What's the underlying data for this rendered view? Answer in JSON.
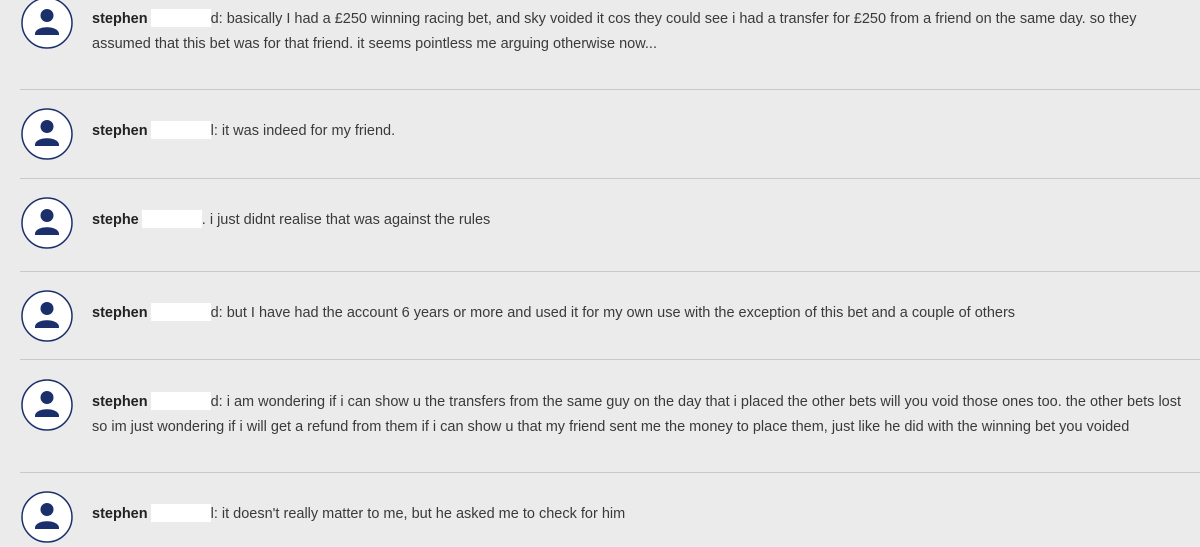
{
  "messages": [
    {
      "sender": "stephen",
      "separator": "d:",
      "text": "basically I had a £250 winning racing bet, and sky voided it cos they could see i had a transfer for £250 from a friend on the same day. so they assumed that this bet was for that friend. it seems pointless me arguing otherwise now..."
    },
    {
      "sender": "stephen",
      "separator": "l:",
      "text": "it was indeed for my friend."
    },
    {
      "sender": "stephe",
      "separator": ".",
      "text": "i just didnt realise that was against the rules"
    },
    {
      "sender": "stephen",
      "separator": "d:",
      "text": "but I have had the account 6 years or more and used it for my own use with the exception of this bet and a couple of others"
    },
    {
      "sender": "stephen",
      "separator": "d:",
      "text": "i am wondering if i can show u the transfers from the same guy on the day that i placed the other bets will you void those ones too. the other bets lost so im just wondering if i will get a refund from them if i can show u that my friend sent me the money to place them, just like he did with the winning bet you voided"
    },
    {
      "sender": "stephen",
      "separator": "l:",
      "text": "it doesn't really matter to me, but he asked me to check for him"
    }
  ],
  "avatar_icon": "user-avatar-icon",
  "colors": {
    "background": "#ebebeb",
    "avatar_fill": "#1b2f6b",
    "avatar_ring": "#1b2f6b",
    "separator_line": "#c9c9c9"
  }
}
